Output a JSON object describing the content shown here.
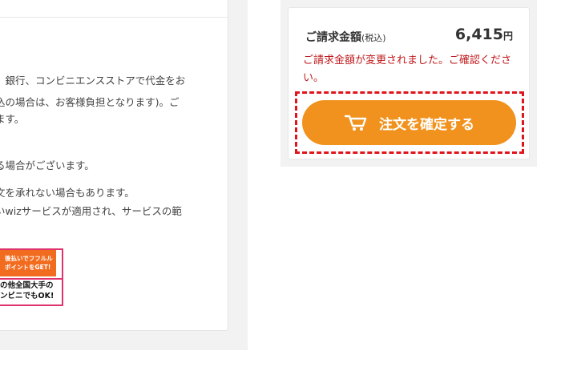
{
  "left": {
    "lines": [
      "、銀行、コンビニエンスストアで代金をお",
      "込の場合は、お客様負担となります)。ご",
      "ます。",
      "る場合がございます。",
      "文を承れない場合もあります。",
      "いwizサービスが適用され、サービスの範"
    ],
    "banner": {
      "top_text_1": "後払いでフフルル",
      "top_text_2": "ポイントをGET!",
      "bottom_text_1": "の他全国大手の",
      "bottom_text_2": "ンビニでもOK!"
    }
  },
  "summary": {
    "billing_label": "ご請求金額",
    "tax_label": "(税込)",
    "amount": "6,415",
    "currency": "円",
    "notice": "ご請求金額が変更されました。ご確認ください。",
    "confirm_label": "注文を確定する",
    "cart_icon": "cart-icon"
  },
  "colors": {
    "accent": "#f1921e",
    "alert": "#c0181b",
    "highlight": "#e0151c"
  }
}
